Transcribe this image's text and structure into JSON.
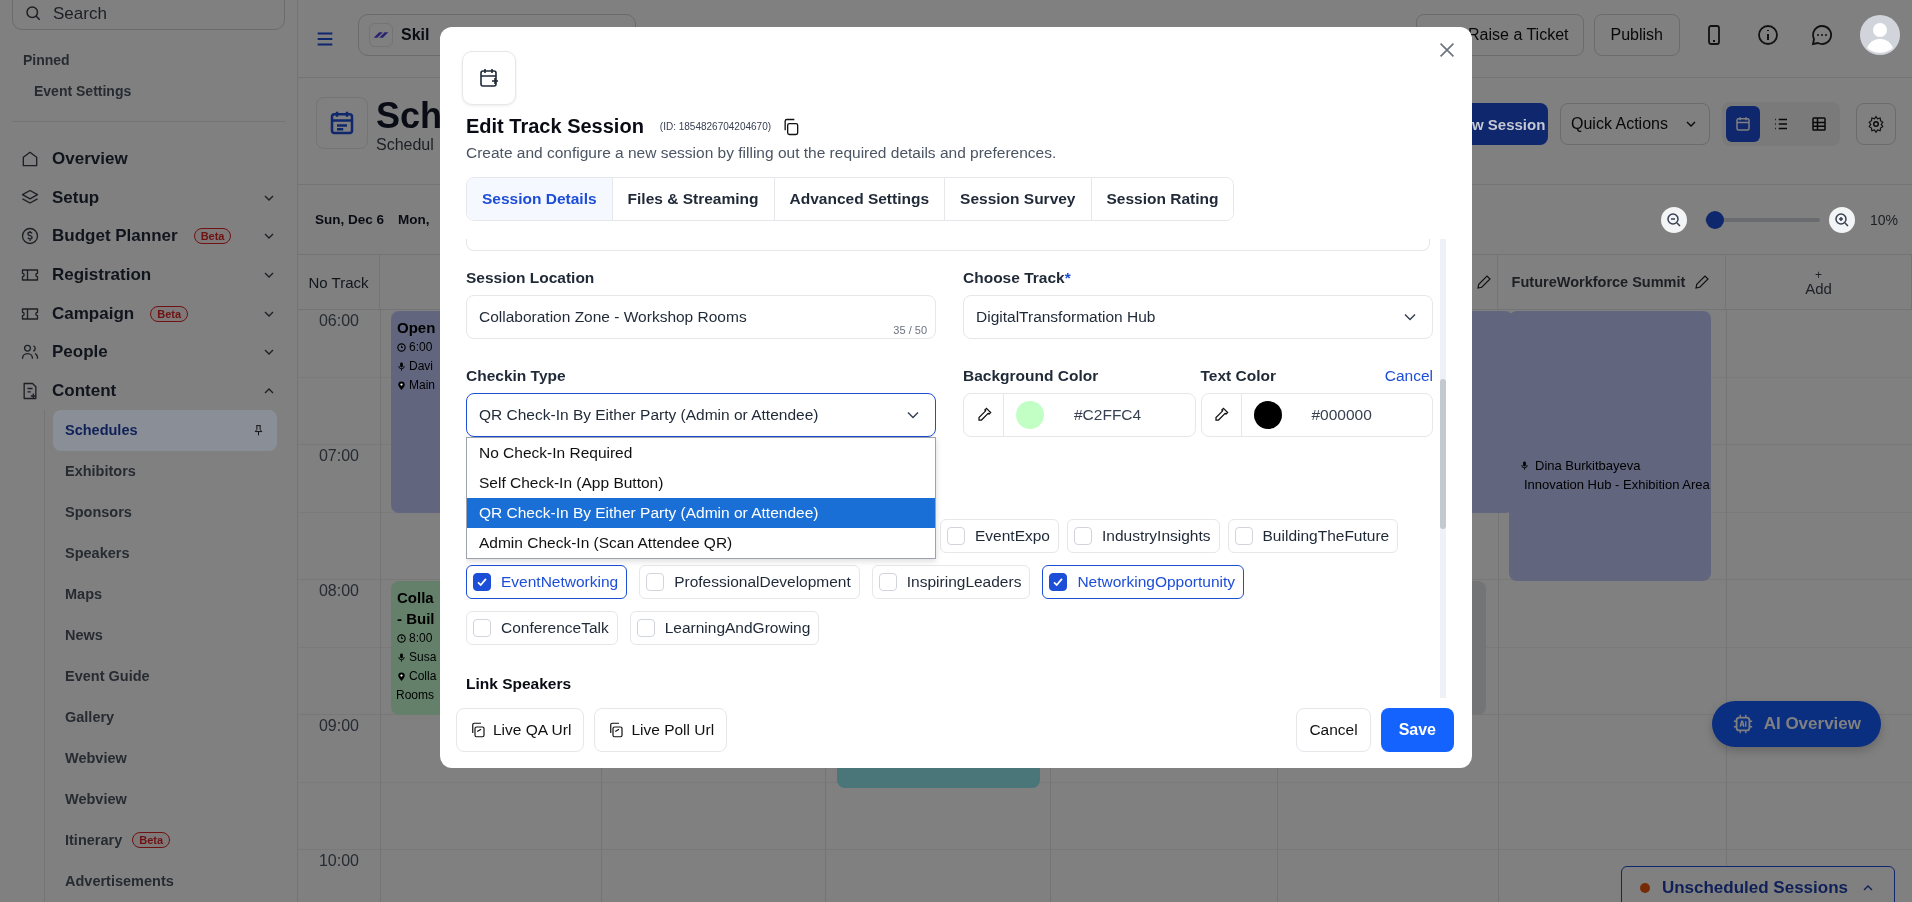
{
  "sidebar": {
    "search": {
      "placeholder": "Search"
    },
    "pinned_heading": "Pinned",
    "pinned_items": [
      "Event Settings"
    ],
    "nav": [
      {
        "label": "Overview"
      },
      {
        "label": "Setup",
        "expanded": false
      },
      {
        "label": "Budget Planner",
        "badge": "Beta",
        "expanded": false
      },
      {
        "label": "Registration",
        "expanded": false
      },
      {
        "label": "Campaign",
        "badge": "Beta",
        "expanded": false
      },
      {
        "label": "People",
        "expanded": false
      },
      {
        "label": "Content",
        "expanded": true,
        "children": [
          {
            "label": "Schedules",
            "selected": true,
            "pinned": true
          },
          {
            "label": "Exhibitors",
            "selected": false,
            "pinned": false
          },
          {
            "label": "Sponsors",
            "selected": false,
            "pinned": false
          },
          {
            "label": "Speakers",
            "selected": false,
            "pinned": false
          },
          {
            "label": "Maps",
            "selected": false,
            "pinned": false
          },
          {
            "label": "News",
            "selected": false,
            "pinned": false
          },
          {
            "label": "Event Guide",
            "selected": false,
            "pinned": false
          },
          {
            "label": "Gallery",
            "selected": false,
            "pinned": false
          },
          {
            "label": "Webview",
            "selected": false,
            "pinned": false
          },
          {
            "label": "Webview",
            "selected": false,
            "pinned": false
          },
          {
            "label": "Itinerary",
            "badge": "Beta",
            "selected": false,
            "pinned": false
          },
          {
            "label": "Advertisements",
            "selected": false,
            "pinned": false
          }
        ]
      }
    ]
  },
  "topbar": {
    "event_name": "Skil",
    "buttons": [
      "Raise a Ticket",
      "Publish"
    ]
  },
  "header": {
    "title": "Sch",
    "subtitle": "Schedul",
    "new_session": "w Session",
    "quick_actions": "Quick Actions",
    "views": [
      {
        "selected": true
      },
      {
        "selected": false
      },
      {
        "selected": false
      }
    ]
  },
  "date_bar": {
    "dates": [
      "Sun, Dec 6",
      "Mon,"
    ],
    "zoom": {
      "level": 0.08,
      "reading": "10%"
    }
  },
  "calendar": {
    "first_column": "No Track",
    "track": "FutureWorkforce Summit",
    "add_sign": "+",
    "add": "Add",
    "times": [
      "06:00",
      "07:00",
      "08:00",
      "09:00",
      "10:00"
    ],
    "events": [
      {
        "title_lines": [
          "Open"
        ],
        "time": "6:00",
        "speaker": "Davi",
        "location_lines": [
          "Main"
        ],
        "color": "#61667e"
      },
      {
        "title_lines": [
          "Colla",
          "- Buil"
        ],
        "time": "8:00",
        "speaker": "Susa",
        "location_lines": [
          "Colla",
          "Rooms"
        ],
        "color": "#64806a"
      },
      {
        "color": "#61667e"
      },
      {
        "speaker": "Dina Burkitbayeva",
        "location_lines": [
          "Innovation Hub - Exhibition Area"
        ],
        "color": "#61667e"
      },
      {
        "color": "#4a7579"
      },
      {
        "color": "#737476"
      }
    ]
  },
  "ai_overview": "AI Overview",
  "unscheduled": "Unscheduled Sessions",
  "modal": {
    "title": "Edit Track Session",
    "id_text": "(ID: 1854826704204670)",
    "subtitle": "Create and configure a new session by filling out the required details and preferences.",
    "tabs": [
      {
        "label": "Session Details",
        "selected": true
      },
      {
        "label": "Files & Streaming",
        "selected": false
      },
      {
        "label": "Advanced Settings",
        "selected": false
      },
      {
        "label": "Session Survey",
        "selected": false
      },
      {
        "label": "Session Rating",
        "selected": false
      }
    ],
    "session_location": {
      "label": "Session Location",
      "value": "Collaboration Zone - Workshop Rooms",
      "counter": "35 / 50"
    },
    "choose_track": {
      "label": "Choose Track",
      "required_mark": "*",
      "value": "DigitalTransformation Hub"
    },
    "checkin_type": {
      "label": "Checkin Type",
      "value": "QR Check-In By Either Party (Admin or Attendee)",
      "expanded": true,
      "options": [
        {
          "label": "No Check-In Required",
          "selected": false
        },
        {
          "label": "Self Check-In (App Button)",
          "selected": false
        },
        {
          "label": "QR Check-In By Either Party (Admin or Attendee)",
          "selected": true
        },
        {
          "label": "Admin Check-In (Scan Attendee QR)",
          "selected": false
        }
      ]
    },
    "background_color": {
      "label": "Background Color",
      "value": "#C2FFC4"
    },
    "text_color": {
      "label": "Text Color",
      "value": "#000000",
      "cancel": "Cancel"
    },
    "tag_rows": [
      [
        {
          "label": "EventExpo",
          "checked": false
        },
        {
          "label": "IndustryInsights",
          "checked": false
        },
        {
          "label": "BuildingTheFuture",
          "checked": false
        }
      ],
      [
        {
          "label": "EventNetworking",
          "checked": true
        },
        {
          "label": "ProfessionalDevelopment",
          "checked": false
        },
        {
          "label": "InspiringLeaders",
          "checked": false
        },
        {
          "label": "NetworkingOpportunity",
          "checked": true
        }
      ],
      [
        {
          "label": "ConferenceTalk",
          "checked": false
        },
        {
          "label": "LearningAndGrowing",
          "checked": false
        }
      ]
    ],
    "link_speakers": "Link Speakers",
    "footer": {
      "links": [
        "Live QA Url",
        "Live Poll Url"
      ],
      "cancel": "Cancel",
      "save": "Save"
    }
  }
}
